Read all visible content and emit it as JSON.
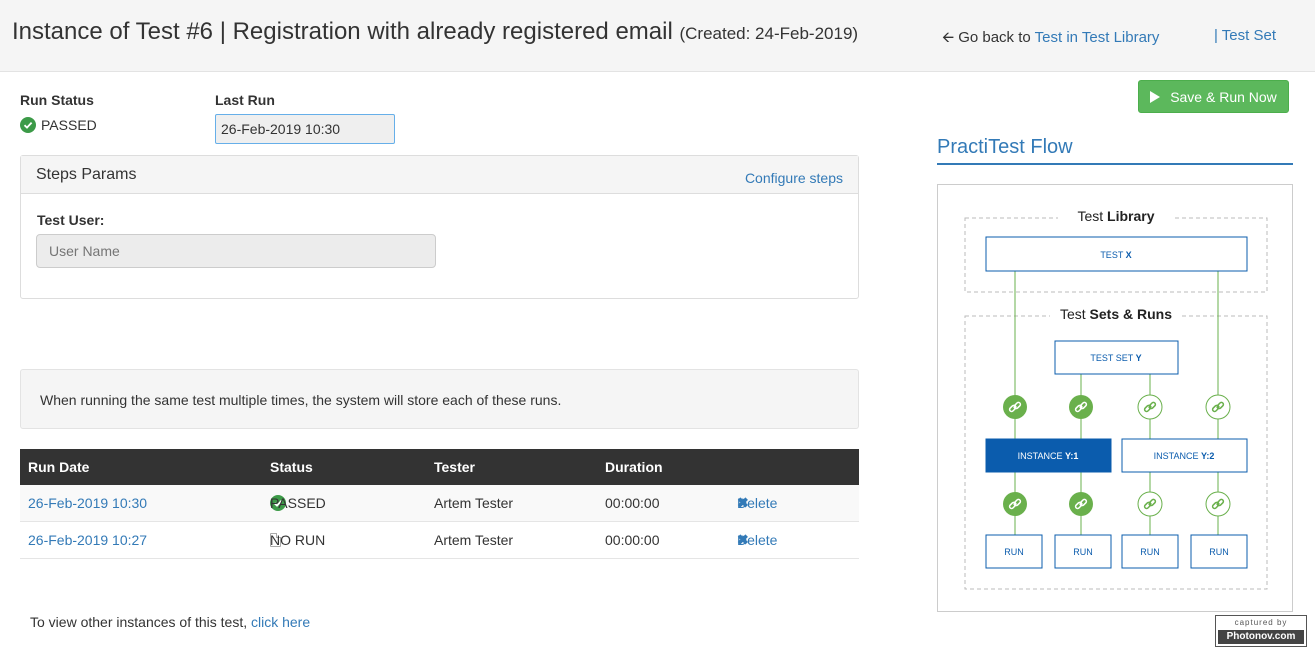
{
  "header": {
    "title": "Instance of Test #6 | Registration with already registered email",
    "created": "(Created: 24-Feb-2019)",
    "back_prefix": "Go back to",
    "back_link": "Test in Test Library",
    "testset_link": "| Test Set"
  },
  "run_status": {
    "label": "Run Status",
    "value": "PASSED"
  },
  "last_run": {
    "label": "Last Run",
    "value": "26-Feb-2019 10:30"
  },
  "steps_params": {
    "title": "Steps Params",
    "configure": "Configure steps",
    "test_user_label": "Test User:",
    "test_user_placeholder": "User Name"
  },
  "info_message": "When running the same test multiple times, the system will store each of these runs.",
  "runs_table": {
    "headers": [
      "Run Date",
      "Status",
      "Tester",
      "Duration"
    ],
    "rows": [
      {
        "date": "26-Feb-2019 10:30",
        "status": "PASSED",
        "tester": "Artem Tester",
        "duration": "00:00:00",
        "action": "Delete"
      },
      {
        "date": "26-Feb-2019 10:27",
        "status": "NO RUN",
        "tester": "Artem Tester",
        "duration": "00:00:00",
        "action": "Delete"
      }
    ]
  },
  "footer": {
    "text": "To view other instances of this test,",
    "link": "click here"
  },
  "save_run_button": "Save & Run Now",
  "flow": {
    "title": "PractiTest Flow",
    "library_label_a": "Test ",
    "library_label_b": "Library",
    "test_x_a": "TEST ",
    "test_x_b": "X",
    "sets_label_a": "Test ",
    "sets_label_b": "Sets & Runs",
    "test_set_a": "TEST SET ",
    "test_set_b": "Y",
    "inst1_a": "INSTANCE ",
    "inst1_b": "Y:1",
    "inst2_a": "INSTANCE ",
    "inst2_b": "Y:2",
    "run": "RUN"
  },
  "watermark": {
    "line1": "captured by",
    "line2": "Photonov.com"
  },
  "colors": {
    "link": "#337ab7",
    "success": "#5cb85c",
    "passed": "#3c9a48",
    "flow_blue": "#0b5cad",
    "flow_green": "#6ab04c"
  }
}
